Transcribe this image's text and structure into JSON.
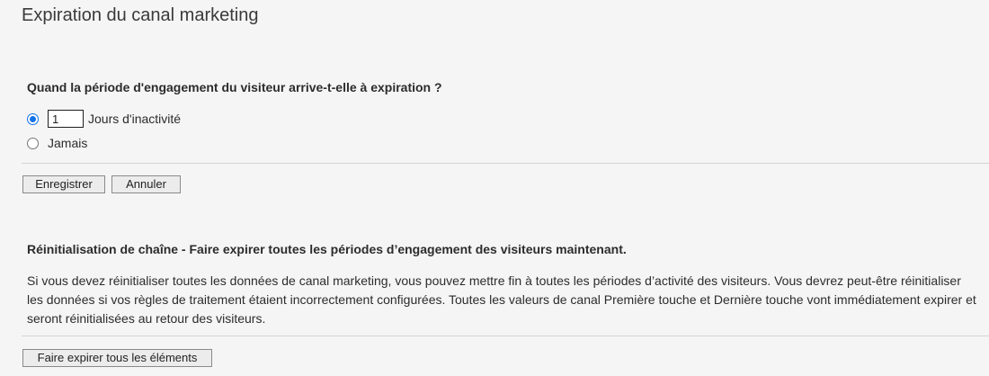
{
  "page": {
    "title": "Expiration du canal marketing"
  },
  "engagement": {
    "question": "Quand la période d'engagement du visiteur arrive-t-elle à expiration ?",
    "days_value": "1",
    "days_label": "Jours d'inactivité",
    "never_label": "Jamais",
    "selected": "days"
  },
  "actions": {
    "save_label": "Enregistrer",
    "cancel_label": "Annuler"
  },
  "reset": {
    "title": "Réinitialisation de chaîne - Faire expirer toutes les périodes d’engagement des visiteurs maintenant.",
    "description": "Si vous devez réinitialiser toutes les données de canal marketing, vous pouvez mettre fin à toutes les périodes d’activité des visiteurs. Vous devrez peut-être réinitialiser les données si vos règles de traitement étaient incorrectement configurées. Toutes les valeurs de canal Première touche et Dernière touche vont immédiatement expirer et seront réinitialisées au retour des visiteurs.",
    "expire_all_label": "Faire expirer tous les éléments"
  }
}
